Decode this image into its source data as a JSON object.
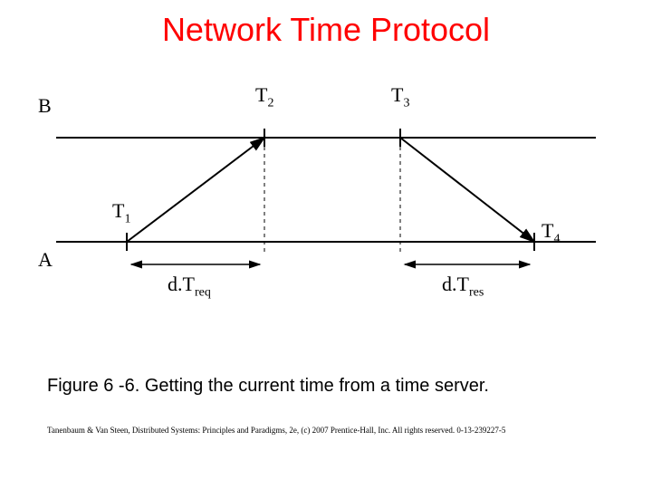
{
  "title": "Network Time Protocol",
  "caption": "Figure 6 -6. Getting the current time from a time server.",
  "footer": "Tanenbaum & Van Steen, Distributed Systems: Principles and Paradigms, 2e, (c) 2007 Prentice-Hall, Inc. All rights reserved. 0-13-239227-5",
  "labels": {
    "B": "B",
    "A": "A",
    "T1": "T",
    "T1sub": "1",
    "T2": "T",
    "T2sub": "2",
    "T3": "T",
    "T3sub": "3",
    "T4": "T",
    "T4sub": "4",
    "dTreq": "d.T",
    "dTreq_sub": "req",
    "dTres": "d.T",
    "dTres_sub": "res"
  }
}
